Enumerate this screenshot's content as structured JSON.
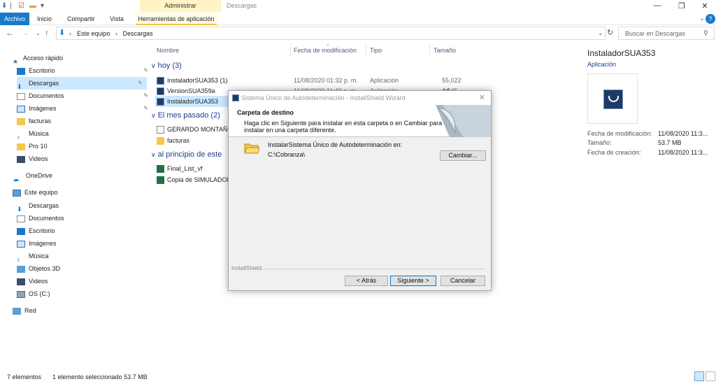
{
  "window": {
    "context_tab": "Administrar",
    "title": "Descargas",
    "min": "—",
    "max": "❐",
    "close": "✕",
    "help": "?"
  },
  "ribbon": {
    "tabs": [
      "Archivo",
      "Inicio",
      "Compartir",
      "Vista",
      "Herramientas de aplicación"
    ]
  },
  "address": {
    "path": [
      "Este equipo",
      "Descargas"
    ],
    "search_placeholder": "Buscar en Descargas"
  },
  "sidebar": {
    "quick_access": "Acceso rápido",
    "quick_items": [
      "Escritorio",
      "Descargas",
      "Documentos",
      "Imágenes",
      "facturas",
      "Música",
      "Pro 10",
      "Videos"
    ],
    "onedrive": "OneDrive",
    "this_pc": "Este equipo",
    "pc_items": [
      "Descargas",
      "Documentos",
      "Escritorio",
      "Imágenes",
      "Música",
      "Objetos 3D",
      "Videos",
      "OS (C:)"
    ],
    "network": "Red"
  },
  "columns": [
    "Nombre",
    "Fecha de modificación",
    "Tipo",
    "Tamaño"
  ],
  "groups": [
    {
      "label": "hoy (3)"
    },
    {
      "label": "El mes pasado (2)"
    },
    {
      "label": "al principio de este"
    }
  ],
  "files_today": [
    {
      "name": "InstaladorSUA353 (1)",
      "date": "11/08/2020 01:32 p. m.",
      "type": "Aplicación",
      "size": "55,022 KB"
    },
    {
      "name": "VersionSUA359a",
      "date": "11/08/2020 11:43 a. m.",
      "type": "Aplicación",
      "size": "4,545 KB"
    },
    {
      "name": "InstaladorSUA353",
      "date": "",
      "type": "",
      "size": ""
    }
  ],
  "files_month": [
    {
      "name": "GERARDO MONTAÑO"
    },
    {
      "name": "facturas"
    }
  ],
  "files_early": [
    {
      "name": "Final_List_vf"
    },
    {
      "name": "Copia de SIMULADOR"
    }
  ],
  "details": {
    "title": "InstaladorSUA353",
    "type": "Aplicación",
    "fields": [
      {
        "k": "Fecha de modificación:",
        "v": "11/08/2020 11:3..."
      },
      {
        "k": "Tamaño:",
        "v": "53.7 MB"
      },
      {
        "k": "Fecha de creación:",
        "v": "11/08/2020 11:3..."
      }
    ]
  },
  "status": {
    "count": "7 elementos",
    "selected": "1 elemento seleccionado  53.7 MB"
  },
  "dialog": {
    "title": "Sistema Único de Autodeterminación - InstallShield Wizard",
    "heading": "Carpeta de destino",
    "desc": "Haga clic en Siguiente para instalar en esta carpeta o en Cambiar para instalar en una carpeta diferente.",
    "install_label": "InstalarSistema Único de Autodeterminación en:",
    "install_path": "C:\\Cobranza\\",
    "change_btn": "Cambiar...",
    "brand": "InstallShield",
    "back_btn": "< Atrás",
    "next_btn": "Siguiente >",
    "cancel_btn": "Cancelar"
  }
}
